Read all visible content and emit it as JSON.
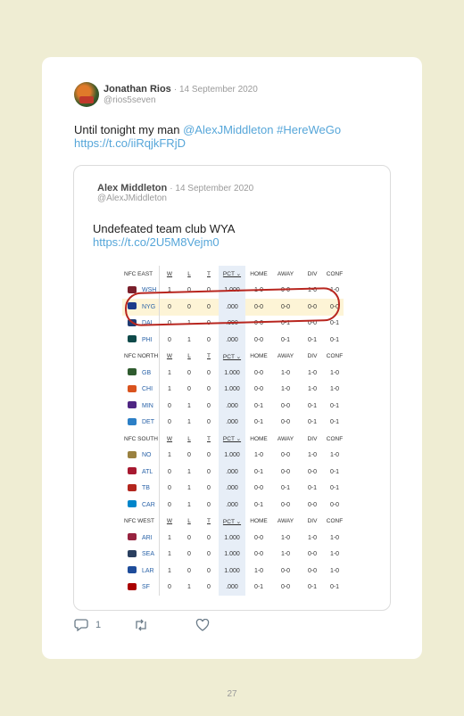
{
  "tweet": {
    "author_name": "Jonathan Rios",
    "date": "· 14 September 2020",
    "handle": "@rios5seven",
    "text_plain": "Until tonight my man ",
    "text_mention": "@AlexJMiddleton",
    "text_hashtag": "#HereWeGo",
    "text_url": "https://t.co/iiRqjkFRjD"
  },
  "quote": {
    "author_name": "Alex Middleton",
    "date": "· 14 September 2020",
    "handle": "@AlexJMiddleton",
    "text": "Undefeated team club WYA",
    "url": "https://t.co/2U5M8Vejm0"
  },
  "standings": {
    "columns": [
      "W",
      "L",
      "T",
      "PCT ⌄",
      "HOME",
      "AWAY",
      "DIV",
      "CONF"
    ],
    "divisions": [
      {
        "name": "NFC EAST",
        "teams": [
          {
            "abbr": "WSH",
            "logo_color": "#7a1f2b",
            "w": "1",
            "l": "0",
            "t": "0",
            "pct": "1.000",
            "home": "1-0",
            "away": "0-0",
            "div": "1-0",
            "conf": "1-0"
          },
          {
            "abbr": "NYG",
            "logo_color": "#1b3a8a",
            "w": "0",
            "l": "0",
            "t": "0",
            "pct": ".000",
            "home": "0-0",
            "away": "0-0",
            "div": "0-0",
            "conf": "0-0"
          },
          {
            "abbr": "DAL",
            "logo_color": "#1f3b73",
            "w": "0",
            "l": "1",
            "t": "0",
            "pct": ".000",
            "home": "0-0",
            "away": "0-1",
            "div": "0-0",
            "conf": "0-1"
          },
          {
            "abbr": "PHI",
            "logo_color": "#0f4a4a",
            "w": "0",
            "l": "1",
            "t": "0",
            "pct": ".000",
            "home": "0-0",
            "away": "0-1",
            "div": "0-1",
            "conf": "0-1"
          }
        ]
      },
      {
        "name": "NFC NORTH",
        "teams": [
          {
            "abbr": "GB",
            "logo_color": "#2f5b2f",
            "w": "1",
            "l": "0",
            "t": "0",
            "pct": "1.000",
            "home": "0-0",
            "away": "1-0",
            "div": "1-0",
            "conf": "1-0"
          },
          {
            "abbr": "CHI",
            "logo_color": "#d9531e",
            "w": "1",
            "l": "0",
            "t": "0",
            "pct": "1.000",
            "home": "0-0",
            "away": "1-0",
            "div": "1-0",
            "conf": "1-0"
          },
          {
            "abbr": "MIN",
            "logo_color": "#4f2683",
            "w": "0",
            "l": "1",
            "t": "0",
            "pct": ".000",
            "home": "0-1",
            "away": "0-0",
            "div": "0-1",
            "conf": "0-1"
          },
          {
            "abbr": "DET",
            "logo_color": "#2c7fc6",
            "w": "0",
            "l": "1",
            "t": "0",
            "pct": ".000",
            "home": "0-1",
            "away": "0-0",
            "div": "0-1",
            "conf": "0-1"
          }
        ]
      },
      {
        "name": "NFC SOUTH",
        "teams": [
          {
            "abbr": "NO",
            "logo_color": "#9a8140",
            "w": "1",
            "l": "0",
            "t": "0",
            "pct": "1.000",
            "home": "1-0",
            "away": "0-0",
            "div": "1-0",
            "conf": "1-0"
          },
          {
            "abbr": "ATL",
            "logo_color": "#a71930",
            "w": "0",
            "l": "1",
            "t": "0",
            "pct": ".000",
            "home": "0-1",
            "away": "0-0",
            "div": "0-0",
            "conf": "0-1"
          },
          {
            "abbr": "TB",
            "logo_color": "#b3261e",
            "w": "0",
            "l": "1",
            "t": "0",
            "pct": ".000",
            "home": "0-0",
            "away": "0-1",
            "div": "0-1",
            "conf": "0-1"
          },
          {
            "abbr": "CAR",
            "logo_color": "#0085ca",
            "w": "0",
            "l": "1",
            "t": "0",
            "pct": ".000",
            "home": "0-1",
            "away": "0-0",
            "div": "0-0",
            "conf": "0-0"
          }
        ]
      },
      {
        "name": "NFC WEST",
        "teams": [
          {
            "abbr": "ARI",
            "logo_color": "#97233f",
            "w": "1",
            "l": "0",
            "t": "0",
            "pct": "1.000",
            "home": "0-0",
            "away": "1-0",
            "div": "1-0",
            "conf": "1-0"
          },
          {
            "abbr": "SEA",
            "logo_color": "#2a3f5f",
            "w": "1",
            "l": "0",
            "t": "0",
            "pct": "1.000",
            "home": "0-0",
            "away": "1-0",
            "div": "0-0",
            "conf": "1-0"
          },
          {
            "abbr": "LAR",
            "logo_color": "#1e4c9a",
            "w": "1",
            "l": "0",
            "t": "0",
            "pct": "1.000",
            "home": "1-0",
            "away": "0-0",
            "div": "0-0",
            "conf": "1-0"
          },
          {
            "abbr": "SF",
            "logo_color": "#aa0000",
            "w": "0",
            "l": "1",
            "t": "0",
            "pct": ".000",
            "home": "0-1",
            "away": "0-0",
            "div": "0-1",
            "conf": "0-1"
          }
        ]
      }
    ]
  },
  "actions": {
    "reply_count": "1",
    "reply_icon": "reply-icon",
    "retweet_icon": "retweet-icon",
    "like_icon": "heart-icon"
  },
  "page_number": "27"
}
